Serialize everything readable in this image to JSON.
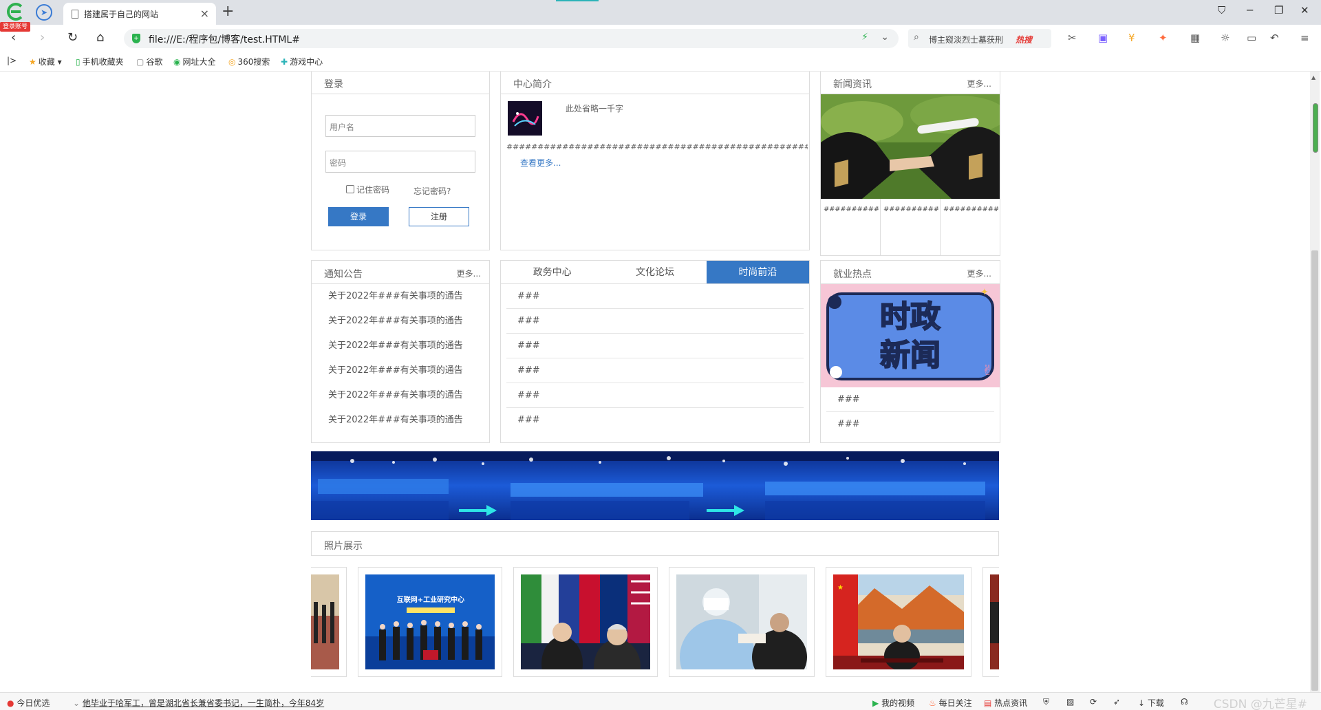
{
  "browser": {
    "login_badge": "登录账号",
    "tab_title": "搭建属于自己的网站",
    "new_tab": "+",
    "url": "file:///E:/程序包/博客/test.HTML#",
    "search_query": "博主窥淡烈士墓获刑",
    "search_hot": "热搜",
    "bookmarks": [
      "收藏",
      "手机收藏夹",
      "谷歌",
      "网址大全",
      "360搜索",
      "游戏中心"
    ]
  },
  "login": {
    "title": "登录",
    "username_placeholder": "用户名",
    "password_placeholder": "密码",
    "remember": "记住密码",
    "forgot": "忘记密码?",
    "login_button": "登录",
    "register_button": "注册"
  },
  "intro": {
    "title": "中心简介",
    "text": "此处省略一千字",
    "hashes": "###########################################################",
    "view_more": "查看更多..."
  },
  "news": {
    "title": "新闻资讯",
    "more": "更多...",
    "cells": [
      "##########",
      "##########",
      "##########"
    ]
  },
  "notices": {
    "title": "通知公告",
    "more": "更多...",
    "items": [
      "关于2022年###有关事项的通告",
      "关于2022年###有关事项的通告",
      "关于2022年###有关事项的通告",
      "关于2022年###有关事项的通告",
      "关于2022年###有关事项的通告",
      "关于2022年###有关事项的通告"
    ]
  },
  "tabs": {
    "labels": [
      "政务中心",
      "文化论坛",
      "时尚前沿"
    ],
    "active_index": 2,
    "items": [
      "###",
      "###",
      "###",
      "###",
      "###",
      "###"
    ]
  },
  "jobs": {
    "title": "就业热点",
    "more": "更多...",
    "image_text_line1": "时政",
    "image_text_line2": "新闻",
    "items": [
      "###",
      "###"
    ]
  },
  "photos": {
    "title": "照片展示",
    "sign_text": "互联网+工业研究中心"
  },
  "statusbar": {
    "today": "今日优选",
    "headline": "他毕业于哈军工，曾是湖北省长兼省委书记，一生简朴，今年84岁",
    "my_video": "我的视频",
    "daily": "每日关注",
    "hot_news": "热点资讯",
    "download": "下载",
    "watermark": "CSDN @九芒星#"
  },
  "colors": {
    "accent": "#3678c5",
    "border": "#dddddd",
    "hot": "#e53935"
  }
}
